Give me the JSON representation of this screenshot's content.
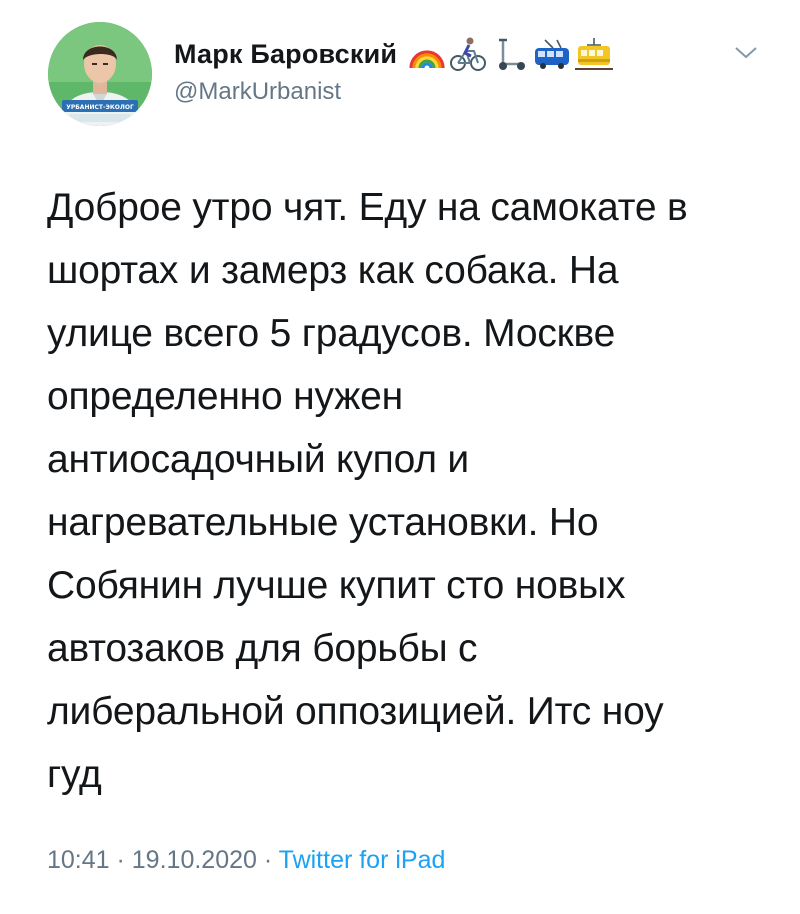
{
  "author": {
    "display_name": "Марк Баровский",
    "handle": "@MarkUrbanist",
    "avatar_badge": "УРБАНИСТ-ЭКОЛОГ",
    "name_emojis": [
      "rainbow-icon",
      "cyclist-icon",
      "kick-scooter-icon",
      "trolleybus-icon",
      "tram-icon"
    ]
  },
  "tweet": {
    "lines": [
      "Доброе утро чят. Еду на самокате в",
      "шортах и замерз как собака. На",
      "улице всего 5 градусов. Москве",
      "определенно нужен",
      "антиосадочный купол и",
      "нагревательные установки. Но",
      "Собянин лучше купит сто новых",
      "автозаков для борьбы с",
      "либеральной оппозицией. Итс ноу",
      "гуд"
    ]
  },
  "meta": {
    "time": "10:41",
    "separator": " · ",
    "date": "19.10.2020",
    "source": "Twitter for iPad"
  },
  "colors": {
    "text": "#14171a",
    "secondary": "#657786",
    "link": "#1da1f2"
  },
  "icons": {
    "menu": "chevron-down-icon"
  }
}
